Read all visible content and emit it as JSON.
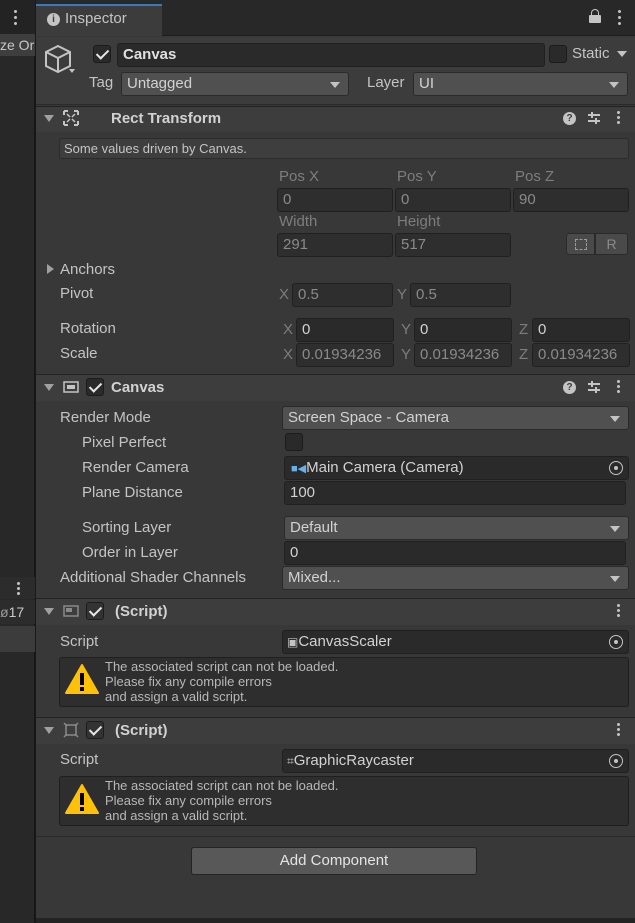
{
  "left_panel": {
    "partial_text": "ze Or",
    "count": "17"
  },
  "inspector": {
    "tab_label": "Inspector",
    "object": {
      "name": "Canvas",
      "active": true,
      "static_label": "Static",
      "tag_label": "Tag",
      "tag_value": "Untagged",
      "layer_label": "Layer",
      "layer_value": "UI"
    },
    "rect_transform": {
      "title": "Rect Transform",
      "info": "Some values driven by Canvas.",
      "pos_x_label": "Pos X",
      "pos_x": "0",
      "pos_y_label": "Pos Y",
      "pos_y": "0",
      "pos_z_label": "Pos Z",
      "pos_z": "90",
      "width_label": "Width",
      "width": "291",
      "height_label": "Height",
      "height": "517",
      "r_button": "R",
      "anchors_label": "Anchors",
      "pivot_label": "Pivot",
      "pivot_x": "0.5",
      "pivot_y": "0.5",
      "rotation_label": "Rotation",
      "rot_x": "0",
      "rot_y": "0",
      "rot_z": "0",
      "scale_label": "Scale",
      "scale_x": "0.01934236",
      "scale_y": "0.01934236",
      "scale_z": "0.01934236",
      "axis_x": "X",
      "axis_y": "Y",
      "axis_z": "Z"
    },
    "canvas": {
      "title": "Canvas",
      "enabled": true,
      "render_mode_label": "Render Mode",
      "render_mode": "Screen Space - Camera",
      "pixel_perfect_label": "Pixel Perfect",
      "pixel_perfect": false,
      "render_camera_label": "Render Camera",
      "render_camera": "Main Camera (Camera)",
      "plane_distance_label": "Plane Distance",
      "plane_distance": "100",
      "sorting_layer_label": "Sorting Layer",
      "sorting_layer": "Default",
      "order_in_layer_label": "Order in Layer",
      "order_in_layer": "0",
      "shader_channels_label": "Additional Shader Channels",
      "shader_channels": "Mixed..."
    },
    "script1": {
      "title": "(Script)",
      "script_label": "Script",
      "script_value": "CanvasScaler",
      "warning": "The associated script can not be loaded.\nPlease fix any compile errors\nand assign a valid script."
    },
    "script2": {
      "title": "(Script)",
      "script_label": "Script",
      "script_value": "GraphicRaycaster",
      "warning": "The associated script can not be loaded.\nPlease fix any compile errors\nand assign a valid script."
    },
    "add_component_label": "Add Component"
  }
}
